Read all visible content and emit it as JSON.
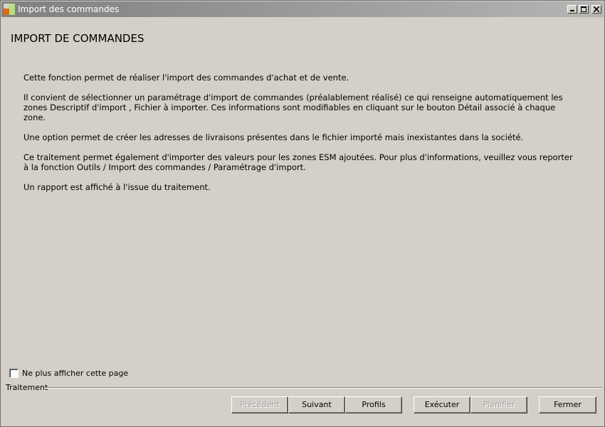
{
  "window": {
    "title": "Import des commandes",
    "controls": {
      "minimize_icon": "minimize-icon",
      "maximize_icon": "maximize-icon",
      "close_icon": "close-icon"
    }
  },
  "page": {
    "title": "IMPORT DE COMMANDES",
    "paragraphs": [
      "Cette fonction permet de réaliser l'import des commandes d'achat et de vente.",
      "Il convient de sélectionner un paramétrage d'import de commandes (préalablement réalisé) ce qui renseigne automatiquement les zones Descriptif d'import , Fichier à importer. Ces informations sont modifiables en cliquant sur le bouton Détail associé à chaque zone.",
      "Une option permet de créer les adresses de livraisons présentes dans le fichier importé mais inexistantes dans la société.",
      "Ce traitement permet également d'importer des valeurs pour les zones ESM ajoutées. Pour plus d'informations, veuillez vous reporter à la fonction Outils / Import des commandes / Paramétrage d'import.",
      "Un rapport est affiché à l'issue du traitement."
    ]
  },
  "options": {
    "hide_page_label": "Ne plus afficher cette page",
    "hide_page_checked": false
  },
  "footer": {
    "group_label": "Traitement",
    "buttons": {
      "previous": "Précédent",
      "next": "Suivant",
      "profiles": "Profils",
      "execute": "Exécuter",
      "schedule": "Planifier",
      "close": "Fermer"
    }
  },
  "colors": {
    "background": "#d4d0c8",
    "titlebar_start": "#808080",
    "titlebar_end": "#b5b5b5",
    "disabled_text": "#a0a0a0"
  }
}
